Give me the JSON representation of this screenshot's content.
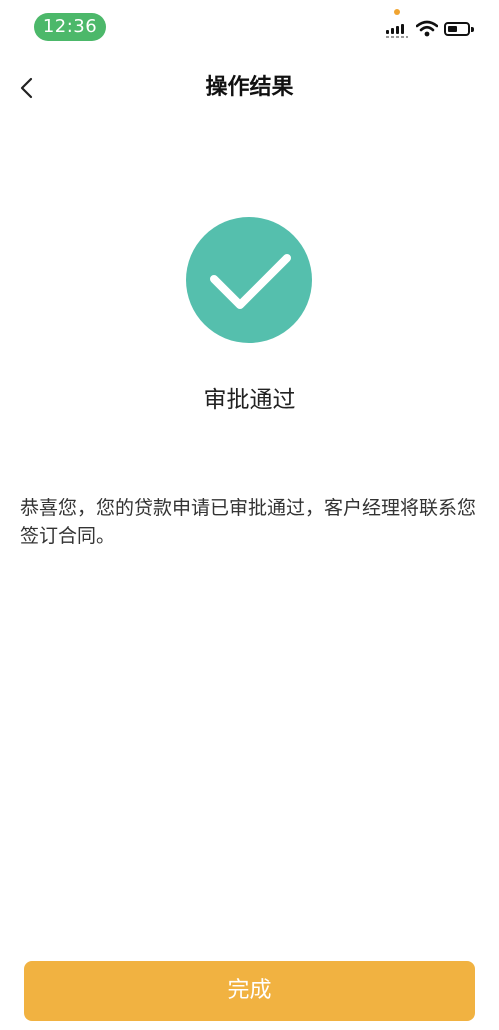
{
  "status_bar": {
    "time": "12:36",
    "icons": [
      "signal-icon",
      "wifi-icon",
      "battery-icon"
    ],
    "accent_color": "#4cb86a"
  },
  "nav": {
    "title": "操作结果",
    "back_icon": "chevron-left-icon"
  },
  "result": {
    "icon": "checkmark-icon",
    "icon_color": "#55bfad",
    "title": "审批通过",
    "message": "恭喜您，您的贷款申请已审批通过，客户经理将联系您签订合同。"
  },
  "footer": {
    "done_label": "完成",
    "button_color": "#f1b241"
  }
}
